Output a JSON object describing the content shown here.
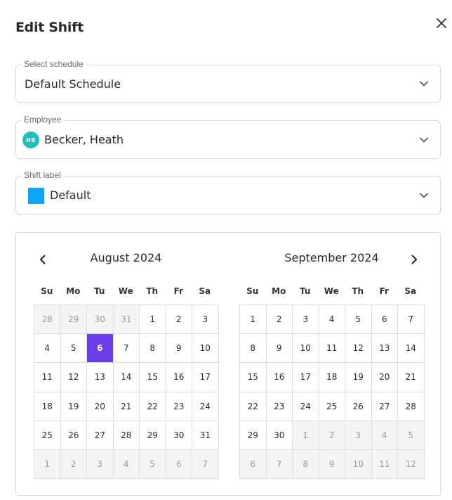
{
  "dialog": {
    "title": "Edit Shift"
  },
  "icons": {
    "close": "close-icon",
    "chevron": "chevron-down-icon",
    "prev": "chevron-left-icon",
    "next": "chevron-right-icon"
  },
  "schedule": {
    "label": "Select schedule",
    "value": "Default Schedule"
  },
  "employee": {
    "label": "Employee",
    "initials": "HB",
    "value": "Becker, Heath",
    "avatar_color": "#1fbfbf"
  },
  "shift_label": {
    "label": "Shift label",
    "value": "Default",
    "swatch_color": "#0ea5f7"
  },
  "colors": {
    "selected_day": "#6a3de8",
    "muted_bg": "#f4f4f4"
  },
  "calendar": {
    "weekdays": [
      "Su",
      "Mo",
      "Tu",
      "We",
      "Th",
      "Fr",
      "Sa"
    ],
    "months": [
      {
        "title": "August 2024",
        "days": [
          {
            "d": "28",
            "out": true
          },
          {
            "d": "29",
            "out": true
          },
          {
            "d": "30",
            "out": true
          },
          {
            "d": "31",
            "out": true
          },
          {
            "d": "1"
          },
          {
            "d": "2"
          },
          {
            "d": "3"
          },
          {
            "d": "4"
          },
          {
            "d": "5"
          },
          {
            "d": "6",
            "selected": true
          },
          {
            "d": "7"
          },
          {
            "d": "8"
          },
          {
            "d": "9"
          },
          {
            "d": "10"
          },
          {
            "d": "11"
          },
          {
            "d": "12"
          },
          {
            "d": "13"
          },
          {
            "d": "14"
          },
          {
            "d": "15"
          },
          {
            "d": "16"
          },
          {
            "d": "17"
          },
          {
            "d": "18"
          },
          {
            "d": "19"
          },
          {
            "d": "20"
          },
          {
            "d": "21"
          },
          {
            "d": "22"
          },
          {
            "d": "23"
          },
          {
            "d": "24"
          },
          {
            "d": "25"
          },
          {
            "d": "26"
          },
          {
            "d": "27"
          },
          {
            "d": "28"
          },
          {
            "d": "29"
          },
          {
            "d": "30"
          },
          {
            "d": "31"
          },
          {
            "d": "1",
            "out": true
          },
          {
            "d": "2",
            "out": true
          },
          {
            "d": "3",
            "out": true
          },
          {
            "d": "4",
            "out": true
          },
          {
            "d": "5",
            "out": true
          },
          {
            "d": "6",
            "out": true
          },
          {
            "d": "7",
            "out": true
          }
        ]
      },
      {
        "title": "September 2024",
        "days": [
          {
            "d": "1"
          },
          {
            "d": "2"
          },
          {
            "d": "3"
          },
          {
            "d": "4"
          },
          {
            "d": "5"
          },
          {
            "d": "6"
          },
          {
            "d": "7"
          },
          {
            "d": "8"
          },
          {
            "d": "9"
          },
          {
            "d": "10"
          },
          {
            "d": "11"
          },
          {
            "d": "12"
          },
          {
            "d": "13"
          },
          {
            "d": "14"
          },
          {
            "d": "15"
          },
          {
            "d": "16"
          },
          {
            "d": "17"
          },
          {
            "d": "18"
          },
          {
            "d": "19"
          },
          {
            "d": "20"
          },
          {
            "d": "21"
          },
          {
            "d": "22"
          },
          {
            "d": "23"
          },
          {
            "d": "24"
          },
          {
            "d": "25"
          },
          {
            "d": "26"
          },
          {
            "d": "27"
          },
          {
            "d": "28"
          },
          {
            "d": "29"
          },
          {
            "d": "30"
          },
          {
            "d": "1",
            "out": true
          },
          {
            "d": "2",
            "out": true
          },
          {
            "d": "3",
            "out": true
          },
          {
            "d": "4",
            "out": true
          },
          {
            "d": "5",
            "out": true
          },
          {
            "d": "6",
            "out": true
          },
          {
            "d": "7",
            "out": true
          },
          {
            "d": "8",
            "out": true
          },
          {
            "d": "9",
            "out": true
          },
          {
            "d": "10",
            "out": true
          },
          {
            "d": "11",
            "out": true
          },
          {
            "d": "12",
            "out": true
          }
        ]
      }
    ]
  }
}
